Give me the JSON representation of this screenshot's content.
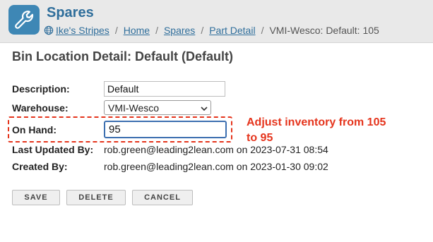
{
  "header": {
    "title": "Spares",
    "icon": "wrench-icon",
    "icon_color": "#3e87b5",
    "breadcrumb": [
      {
        "label": "Ike's Stripes",
        "link": true
      },
      {
        "label": "Home",
        "link": true
      },
      {
        "label": "Spares",
        "link": true
      },
      {
        "label": "Part Detail",
        "link": true
      },
      {
        "label": "VMI-Wesco: Default: 105",
        "link": false
      }
    ]
  },
  "page": {
    "title": "Bin Location Detail: Default (Default)"
  },
  "form": {
    "description": {
      "label": "Description:",
      "value": "Default"
    },
    "warehouse": {
      "label": "Warehouse:",
      "value": "VMI-Wesco"
    },
    "on_hand": {
      "label": "On Hand:",
      "value": "95"
    },
    "last_updated": {
      "label": "Last Updated By:",
      "value": "rob.green@leading2lean.com on 2023-07-31 08:54"
    },
    "created": {
      "label": "Created By:",
      "value": "rob.green@leading2lean.com on 2023-01-30 09:02"
    }
  },
  "annotation": {
    "text": "Adjust inventory from 105 to 95",
    "color": "#e5341c"
  },
  "buttons": {
    "save": "SAVE",
    "delete": "DELETE",
    "cancel": "CANCEL"
  }
}
